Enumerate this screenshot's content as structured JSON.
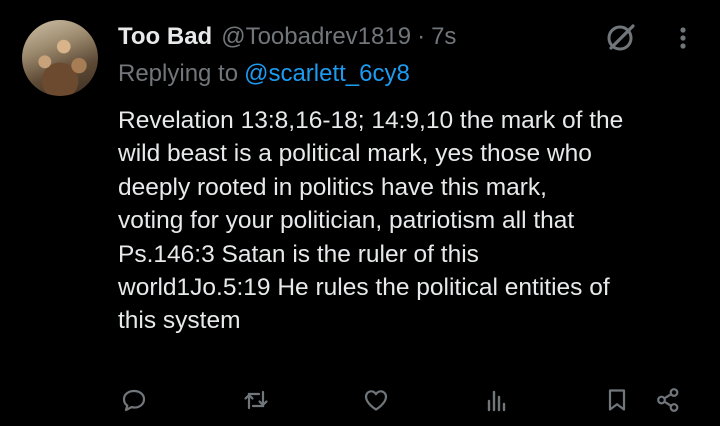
{
  "tweet": {
    "display_name": "Too Bad",
    "handle": "@Toobadrev1819",
    "separator": "·",
    "time": "7s",
    "replying_prefix": "Replying to",
    "replying_to": "@scarlett_6cy8",
    "text": "Revelation 13:8,16-18; 14:9,10 the mark of the\nwild beast is a political mark, yes those who\ndeeply rooted in politics have this mark,\nvoting for your politician, patriotism all that\nPs.146:3 Satan is the ruler of this\nworld1Jo.5:19 He rules the political entities of\nthis system"
  },
  "icons": {
    "grok": "grok-icon",
    "more": "more-icon",
    "reply": "reply-icon",
    "retweet": "retweet-icon",
    "like": "heart-icon",
    "views": "views-icon",
    "bookmark": "bookmark-icon",
    "share": "share-icon"
  },
  "colors": {
    "background": "#000000",
    "text": "#e7e9ea",
    "muted": "#71767b",
    "link": "#1d9bf0"
  }
}
